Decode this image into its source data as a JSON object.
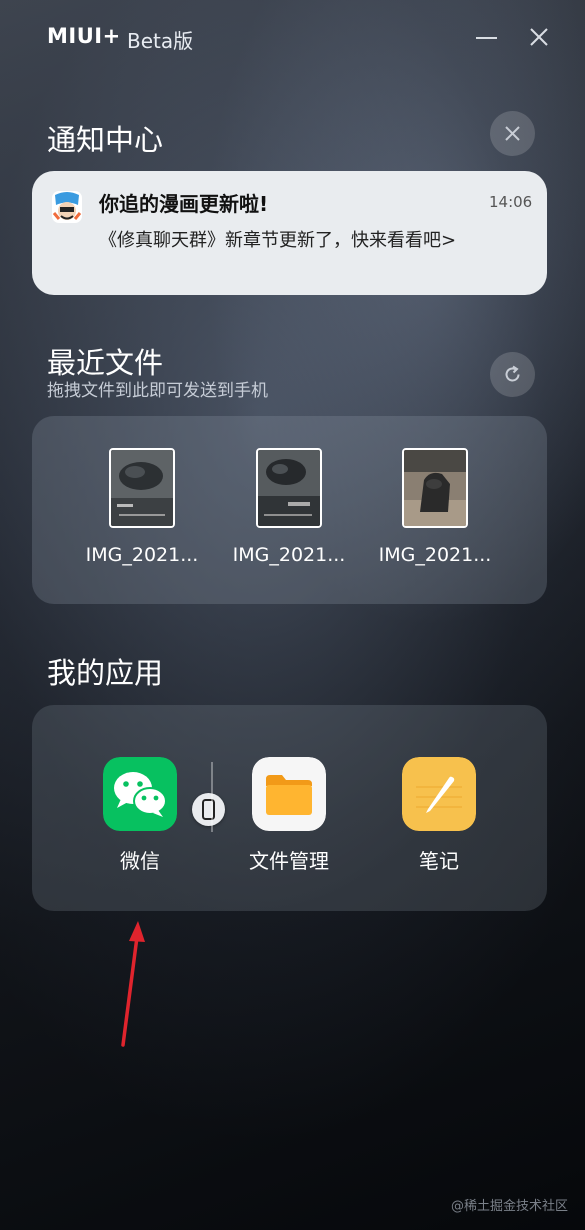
{
  "titlebar": {
    "brand": "MIUI+",
    "beta": "Beta版"
  },
  "notifications": {
    "title": "通知中心",
    "item": {
      "title": "你追的漫画更新啦!",
      "time": "14:06",
      "body": "《修真聊天群》新章节更新了，快来看看吧>"
    }
  },
  "files": {
    "title": "最近文件",
    "subtitle": "拖拽文件到此即可发送到手机",
    "items": [
      {
        "name": "IMG_2021..."
      },
      {
        "name": "IMG_2021..."
      },
      {
        "name": "IMG_2021..."
      }
    ]
  },
  "apps": {
    "title": "我的应用",
    "items": [
      {
        "label": "微信",
        "icon": "wechat-icon"
      },
      {
        "label": "文件管理",
        "icon": "folder-icon"
      },
      {
        "label": "笔记",
        "icon": "notes-icon"
      }
    ]
  },
  "watermark": "@稀土掘金技术社区",
  "colors": {
    "wechat": "#07c160",
    "folder": "#ffb02e",
    "notes": "#f7c14d",
    "arrow": "#e0242d"
  }
}
